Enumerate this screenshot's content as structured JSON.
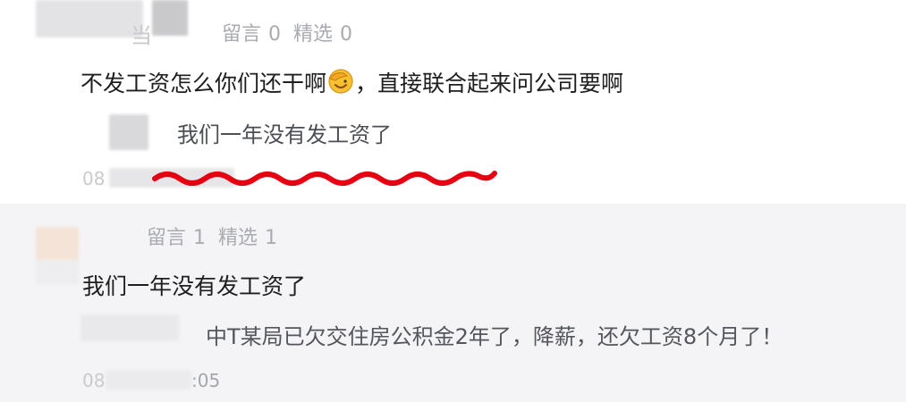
{
  "colors": {
    "accent_underline": "#e60012",
    "secondary_text": "#a9abb2",
    "primary_text": "#1e1e1e"
  },
  "comments": [
    {
      "username_fragment": "当",
      "stats": {
        "comments_label": "留言",
        "comments_count": "0",
        "featured_label": "精选",
        "featured_count": "0"
      },
      "text_before_emoji": "不发工资怎么你们还干啊",
      "emoji_icon": "facepalm-emoji",
      "text_after_emoji": "，直接联合起来问公司要啊",
      "reply_text": "我们一年没有发工资了",
      "timestamp_fragment": "08"
    },
    {
      "stats": {
        "comments_label": "留言",
        "comments_count": "1",
        "featured_label": "精选",
        "featured_count": "1"
      },
      "text": "我们一年没有发工资了",
      "reply_text": "中T某局已欠交住房公积金2年了，降薪，还欠工资8个月了！",
      "timestamp_fragment_start": "08",
      "timestamp_fragment_end": ":05"
    }
  ]
}
